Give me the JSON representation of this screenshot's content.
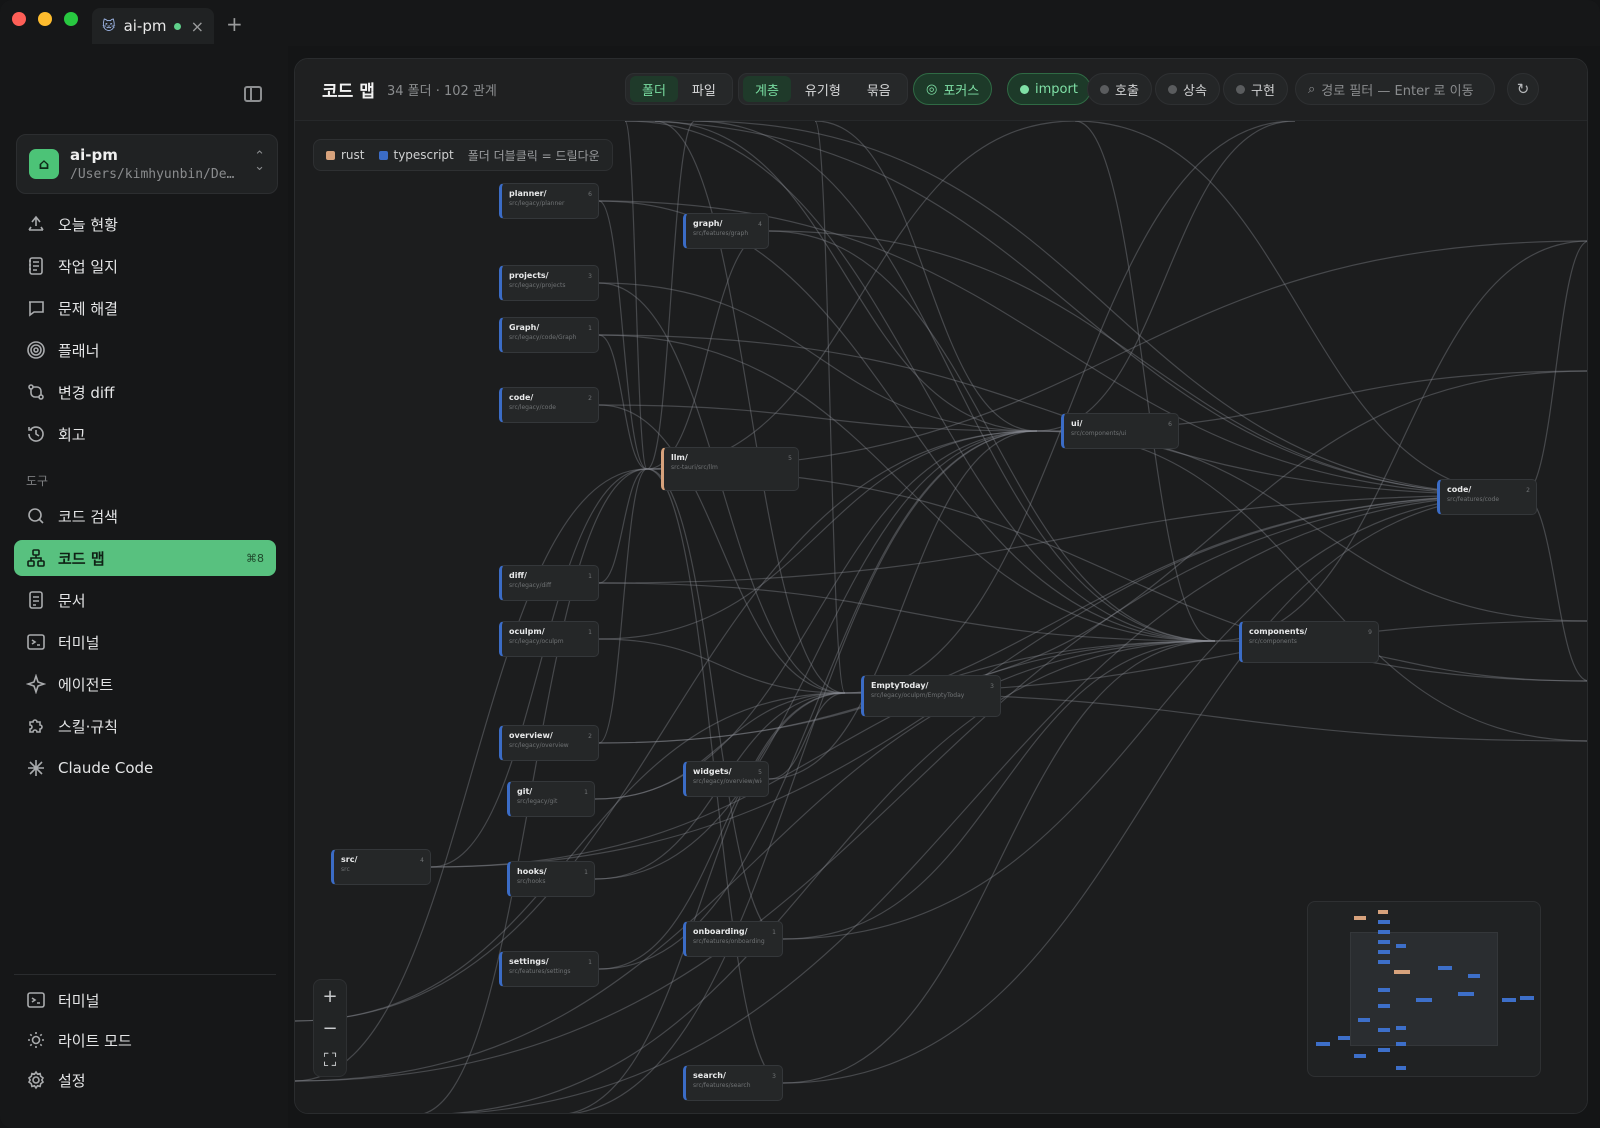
{
  "titlebar": {
    "tab_label": "ai-pm",
    "new_tab": "+",
    "close": "×"
  },
  "project": {
    "name": "ai-pm",
    "path": "/Users/kimhyunbin/De..."
  },
  "nav": {
    "primary": [
      {
        "label": "오늘 현황",
        "icon": "today-icon"
      },
      {
        "label": "작업 일지",
        "icon": "journal-icon"
      },
      {
        "label": "문제 해결",
        "icon": "chat-icon"
      },
      {
        "label": "플래너",
        "icon": "target-icon"
      },
      {
        "label": "변경 diff",
        "icon": "diff-icon"
      },
      {
        "label": "회고",
        "icon": "history-icon"
      }
    ],
    "tools_label": "도구",
    "tools": [
      {
        "label": "코드 검색",
        "icon": "search-icon"
      },
      {
        "label": "코드 맵",
        "icon": "sitemap-icon",
        "shortcut": "⌘8",
        "active": true
      },
      {
        "label": "문서",
        "icon": "document-icon"
      },
      {
        "label": "터미널",
        "icon": "terminal-icon"
      },
      {
        "label": "에이전트",
        "icon": "sparkle-icon"
      },
      {
        "label": "스킬·규칙",
        "icon": "puzzle-icon"
      },
      {
        "label": "Claude Code",
        "icon": "claude-icon"
      }
    ],
    "bottom": [
      {
        "label": "터미널",
        "icon": "terminal-icon"
      },
      {
        "label": "라이트 모드",
        "icon": "sun-icon"
      },
      {
        "label": "설정",
        "icon": "gear-icon"
      }
    ]
  },
  "header": {
    "title": "코드 맵",
    "subtitle": "34 폴더 · 102 관계",
    "granularity": [
      "폴더",
      "파일"
    ],
    "layout": [
      "계층",
      "유기형",
      "묶음"
    ],
    "focus_label": "포커스",
    "relations": [
      "import",
      "호출",
      "상속",
      "구현"
    ],
    "search_placeholder": "경로 필터 — Enter 로 이동"
  },
  "legend": {
    "rust": "rust",
    "typescript": "typescript",
    "hint": "폴더 더블클릭 = 드릴다운"
  },
  "colors": {
    "accent": "#58c17f",
    "rust": "#d7a27c",
    "typescript": "#3b6cc6"
  },
  "nodes": [
    {
      "id": "planner",
      "name": "planner/",
      "path": "src/legacy/planner",
      "count": "6"
    },
    {
      "id": "graph",
      "name": "graph/",
      "path": "src/features/graph",
      "count": "4"
    },
    {
      "id": "projects",
      "name": "projects/",
      "path": "src/legacy/projects",
      "count": "3"
    },
    {
      "id": "Graph",
      "name": "Graph/",
      "path": "src/legacy/code/Graph",
      "count": "1"
    },
    {
      "id": "code1",
      "name": "code/",
      "path": "src/legacy/code",
      "count": "2"
    },
    {
      "id": "llm",
      "name": "llm/",
      "path": "src-tauri/src/llm",
      "count": "5"
    },
    {
      "id": "ui",
      "name": "ui/",
      "path": "src/components/ui",
      "count": "6"
    },
    {
      "id": "code2",
      "name": "code/",
      "path": "src/features/code",
      "count": "2"
    },
    {
      "id": "diff",
      "name": "diff/",
      "path": "src/legacy/diff",
      "count": "1"
    },
    {
      "id": "oculpm",
      "name": "oculpm/",
      "path": "src/legacy/oculpm",
      "count": "1"
    },
    {
      "id": "components",
      "name": "components/",
      "path": "src/components",
      "count": "9"
    },
    {
      "id": "emptytoday",
      "name": "EmptyToday/",
      "path": "src/legacy/oculpm/EmptyToday",
      "count": "3"
    },
    {
      "id": "overview",
      "name": "overview/",
      "path": "src/legacy/overview",
      "count": "2"
    },
    {
      "id": "widgets",
      "name": "widgets/",
      "path": "src/legacy/overview/widg...",
      "count": "5"
    },
    {
      "id": "git",
      "name": "git/",
      "path": "src/legacy/git",
      "count": "1"
    },
    {
      "id": "src",
      "name": "src/",
      "path": "src",
      "count": "4"
    },
    {
      "id": "hooks",
      "name": "hooks/",
      "path": "src/hooks",
      "count": "1"
    },
    {
      "id": "onboarding",
      "name": "onboarding/",
      "path": "src/features/onboarding",
      "count": "1"
    },
    {
      "id": "settings",
      "name": "settings/",
      "path": "src/features/settings",
      "count": "1"
    },
    {
      "id": "search",
      "name": "search/",
      "path": "src/features/search",
      "count": "3"
    }
  ],
  "zoom": {
    "in": "+",
    "out": "−",
    "fit": "⛶"
  }
}
